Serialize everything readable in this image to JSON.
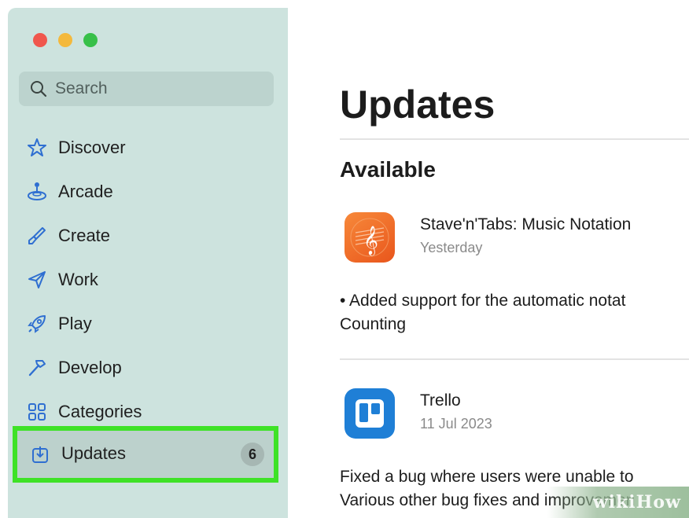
{
  "sidebar": {
    "search_placeholder": "Search",
    "items": [
      {
        "label": "Discover",
        "icon": "star-icon"
      },
      {
        "label": "Arcade",
        "icon": "joystick-icon"
      },
      {
        "label": "Create",
        "icon": "brush-icon"
      },
      {
        "label": "Work",
        "icon": "paper-plane-icon"
      },
      {
        "label": "Play",
        "icon": "rocket-icon"
      },
      {
        "label": "Develop",
        "icon": "hammer-icon"
      },
      {
        "label": "Categories",
        "icon": "grid-icon"
      }
    ],
    "updates": {
      "label": "Updates",
      "badge": "6",
      "icon": "download-icon"
    }
  },
  "main": {
    "title": "Updates",
    "section": "Available",
    "apps": [
      {
        "name": "Stave'n'Tabs: Music Notation",
        "date": "Yesterday",
        "notes": [
          "• Added support for the automatic notat",
          "Counting"
        ],
        "icon": "music-clef-icon",
        "icon_color": "#ef6a22"
      },
      {
        "name": "Trello",
        "date": "11 Jul 2023",
        "notes": [
          "Fixed a bug where users were unable to",
          "Various other bug fixes and improvemen"
        ],
        "icon": "trello-icon",
        "icon_color": "#1f7fd6"
      }
    ]
  },
  "watermark": "wikiHow",
  "colors": {
    "highlight": "#3ee227",
    "sidebar": "#cde3de"
  }
}
